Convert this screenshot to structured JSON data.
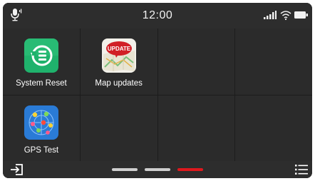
{
  "status": {
    "time": "12:00",
    "icons": [
      "microphone-icon",
      "signal-icon",
      "wifi-icon",
      "battery-icon"
    ]
  },
  "apps": [
    {
      "label": "System Reset",
      "icon": "system-reset-icon",
      "icon_color": "#1fb26c"
    },
    {
      "label": "Map updates",
      "icon": "map-update-icon",
      "icon_badge": "UPDATE",
      "badge_color": "#d11f26"
    },
    {
      "label": "GPS Test",
      "icon": "gps-test-icon",
      "icon_color": "#2a7bd6"
    }
  ],
  "bottom_bar": {
    "icons": [
      "exit-icon",
      "menu-icon"
    ],
    "pages": [
      {
        "label": "page-1",
        "active": false
      },
      {
        "label": "page-2",
        "active": false
      },
      {
        "label": "page-3",
        "active": true
      }
    ],
    "active_color": "#e0181d"
  }
}
